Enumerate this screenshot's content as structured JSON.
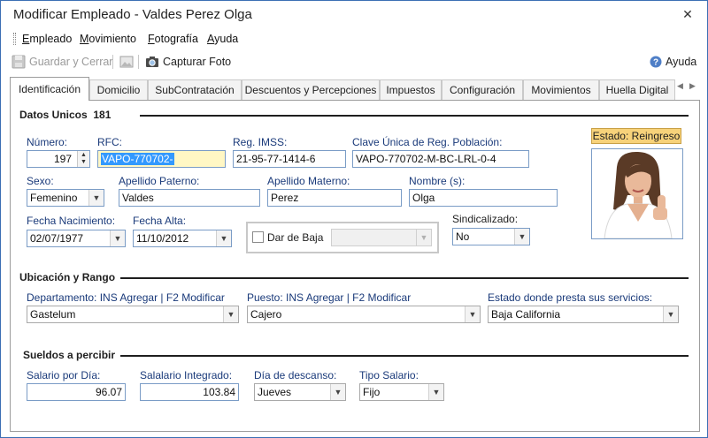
{
  "window": {
    "title": "Modificar Empleado - Valdes Perez Olga"
  },
  "menu": [
    {
      "label_u": "E",
      "label_rest": "mpleado"
    },
    {
      "label_u": "M",
      "label_rest": "ovimiento"
    },
    {
      "label_u": "F",
      "label_rest": "otografía"
    },
    {
      "label_u": "A",
      "label_rest": "yuda"
    }
  ],
  "toolbar": {
    "save_close": "Guardar y Cerrar",
    "capture_photo": "Capturar Foto",
    "help": "Ayuda"
  },
  "tabs": [
    "Identificación",
    "Domicilio",
    "SubContratación",
    "Descuentos y Percepciones",
    "Impuestos",
    "Configuración",
    "Movimientos",
    "Huella Digital"
  ],
  "datos_unicos": {
    "title": "Datos Unicos",
    "id": "181",
    "status": "Estado: Reingreso",
    "numero_label": "Número:",
    "numero": "197",
    "rfc_label": "RFC:",
    "rfc": "VAPO-770702-",
    "imss_label": "Reg. IMSS:",
    "imss": "21-95-77-1414-6",
    "curp_label": "Clave Única de Reg. Población:",
    "curp": "VAPO-770702-M-BC-LRL-0-4",
    "sexo_label": "Sexo:",
    "sexo": "Femenino",
    "paterno_label": "Apellido Paterno:",
    "paterno": "Valdes",
    "materno_label": "Apellido Materno:",
    "materno": "Perez",
    "nombre_label": "Nombre (s):",
    "nombre": "Olga",
    "nacimiento_label": "Fecha Nacimiento:",
    "nacimiento": "02/07/1977",
    "alta_label": "Fecha Alta:",
    "alta": "11/10/2012",
    "baja_label": "Dar de Baja",
    "sindicalizado_label": "Sindicalizado:",
    "sindicalizado": "No"
  },
  "ubicacion": {
    "title": "Ubicación y Rango",
    "departamento_label": "Departamento:  INS Agregar | F2 Modificar",
    "departamento": "Gastelum",
    "puesto_label": "Puesto:  INS Agregar | F2 Modificar",
    "puesto": "Cajero",
    "estado_label": "Estado donde presta sus servicios:",
    "estado": "Baja California"
  },
  "sueldos": {
    "title": "Sueldos a percibir",
    "salario_dia_label": "Salario por Día:",
    "salario_dia": "96.07",
    "salario_integrado_label": "Salalario Integrado:",
    "salario_integrado": "103.84",
    "descanso_label": "Día de descanso:",
    "descanso": "Jueves",
    "tipo_label": "Tipo Salario:",
    "tipo": "Fijo"
  }
}
